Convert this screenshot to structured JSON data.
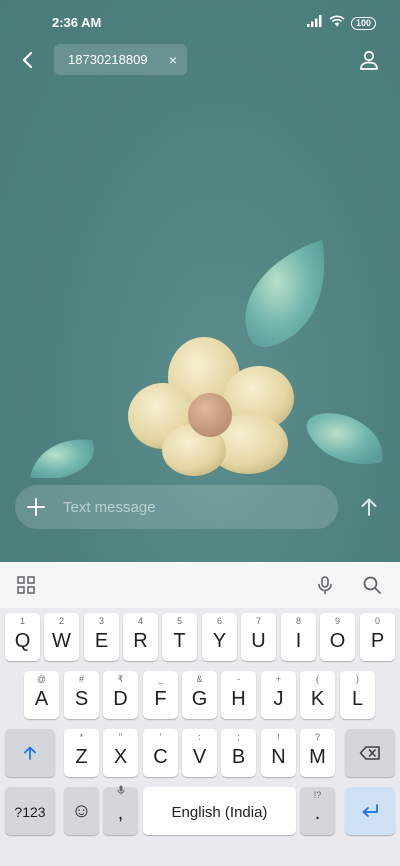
{
  "status": {
    "time": "2:36 AM",
    "battery": "100"
  },
  "header": {
    "recipient": "18730218809",
    "chip_close": "×"
  },
  "compose": {
    "placeholder": "Text message"
  },
  "keyboard": {
    "row1": [
      {
        "key": "Q",
        "hint": "1"
      },
      {
        "key": "W",
        "hint": "2"
      },
      {
        "key": "E",
        "hint": "3"
      },
      {
        "key": "R",
        "hint": "4"
      },
      {
        "key": "T",
        "hint": "5"
      },
      {
        "key": "Y",
        "hint": "6"
      },
      {
        "key": "U",
        "hint": "7"
      },
      {
        "key": "I",
        "hint": "8"
      },
      {
        "key": "O",
        "hint": "9"
      },
      {
        "key": "P",
        "hint": "0"
      }
    ],
    "row2": [
      {
        "key": "A",
        "hint": "@"
      },
      {
        "key": "S",
        "hint": "#"
      },
      {
        "key": "D",
        "hint": "₹"
      },
      {
        "key": "F",
        "hint": "_"
      },
      {
        "key": "G",
        "hint": "&"
      },
      {
        "key": "H",
        "hint": "-"
      },
      {
        "key": "J",
        "hint": "+"
      },
      {
        "key": "K",
        "hint": "("
      },
      {
        "key": "L",
        "hint": ")"
      }
    ],
    "row3": [
      {
        "key": "Z",
        "hint": "*"
      },
      {
        "key": "X",
        "hint": "\""
      },
      {
        "key": "C",
        "hint": "'"
      },
      {
        "key": "V",
        "hint": ":"
      },
      {
        "key": "B",
        "hint": ";"
      },
      {
        "key": "N",
        "hint": "!"
      },
      {
        "key": "M",
        "hint": "?"
      }
    ],
    "symbols": "?123",
    "emoji": "☺",
    "comma": ",",
    "space": "English (India)",
    "period": ".",
    "period_hint": "!?"
  }
}
